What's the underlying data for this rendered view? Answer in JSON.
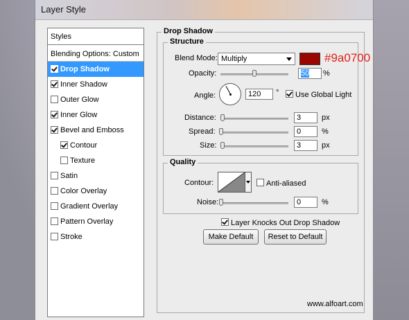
{
  "window": {
    "title": "Layer Style"
  },
  "styles_list": {
    "header": "Styles",
    "blending_options": "Blending Options: Custom",
    "items": [
      {
        "label": "Drop Shadow",
        "checked": true,
        "selected": true,
        "indent": 0
      },
      {
        "label": "Inner Shadow",
        "checked": true,
        "selected": false,
        "indent": 0
      },
      {
        "label": "Outer Glow",
        "checked": false,
        "selected": false,
        "indent": 0
      },
      {
        "label": "Inner Glow",
        "checked": true,
        "selected": false,
        "indent": 0
      },
      {
        "label": "Bevel and Emboss",
        "checked": true,
        "selected": false,
        "indent": 0
      },
      {
        "label": "Contour",
        "checked": true,
        "selected": false,
        "indent": 1
      },
      {
        "label": "Texture",
        "checked": false,
        "selected": false,
        "indent": 1
      },
      {
        "label": "Satin",
        "checked": false,
        "selected": false,
        "indent": 0
      },
      {
        "label": "Color Overlay",
        "checked": false,
        "selected": false,
        "indent": 0
      },
      {
        "label": "Gradient Overlay",
        "checked": false,
        "selected": false,
        "indent": 0
      },
      {
        "label": "Pattern Overlay",
        "checked": false,
        "selected": false,
        "indent": 0
      },
      {
        "label": "Stroke",
        "checked": false,
        "selected": false,
        "indent": 0
      }
    ]
  },
  "drop_shadow": {
    "title": "Drop Shadow",
    "structure": {
      "title": "Structure",
      "blend_mode_label": "Blend Mode:",
      "blend_mode_value": "Multiply",
      "color_swatch": "#9a0700",
      "color_annotation": "#9a0700",
      "opacity_label": "Opacity:",
      "opacity_value": "50",
      "opacity_unit": "%",
      "angle_label": "Angle:",
      "angle_value": "120",
      "angle_unit": "°",
      "use_global_light_label": "Use Global Light",
      "use_global_light_checked": true,
      "distance_label": "Distance:",
      "distance_value": "3",
      "distance_unit": "px",
      "spread_label": "Spread:",
      "spread_value": "0",
      "spread_unit": "%",
      "size_label": "Size:",
      "size_value": "3",
      "size_unit": "px"
    },
    "quality": {
      "title": "Quality",
      "contour_label": "Contour:",
      "anti_aliased_label": "Anti-aliased",
      "anti_aliased_checked": false,
      "noise_label": "Noise:",
      "noise_value": "0",
      "noise_unit": "%"
    },
    "knockout_label": "Layer Knocks Out Drop Shadow",
    "knockout_checked": true,
    "make_default_label": "Make Default",
    "reset_default_label": "Reset to Default"
  },
  "watermark": "www.alfoart.com"
}
